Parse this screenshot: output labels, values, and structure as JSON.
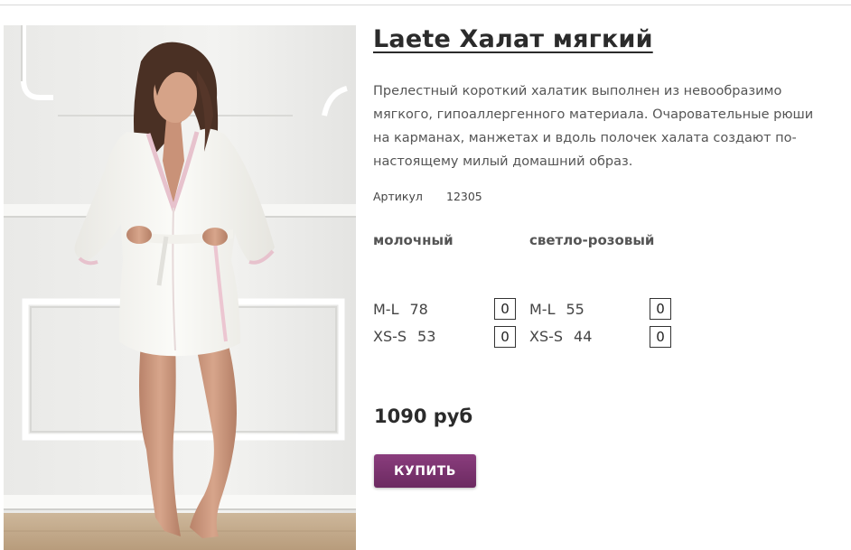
{
  "product": {
    "title": "Laete Халат мягкий",
    "description": "Прелестный короткий халатик выполнен из невообразимо мягкого, гипоаллергенного материала. Очаровательные рюши на карманах, манжетах и вдоль полочек халата создают по-настоящему милый домашний образ.",
    "sku_label": "Артикул",
    "sku_value": "12305",
    "image_alt": "woman-in-white-robe-photo"
  },
  "variants": [
    {
      "color": "молочный",
      "sizes": [
        {
          "size": "M-L",
          "stock": "78",
          "qty": "0"
        },
        {
          "size": "XS-S",
          "stock": "53",
          "qty": "0"
        }
      ]
    },
    {
      "color": "светло-розовый",
      "sizes": [
        {
          "size": "M-L",
          "stock": "55",
          "qty": "0"
        },
        {
          "size": "XS-S",
          "stock": "44",
          "qty": "0"
        }
      ]
    }
  ],
  "price": "1090 руб",
  "buy_label": "КУПИТЬ",
  "colors": {
    "accent": "#7a3470",
    "text": "#333333",
    "background": "#ffffff"
  }
}
